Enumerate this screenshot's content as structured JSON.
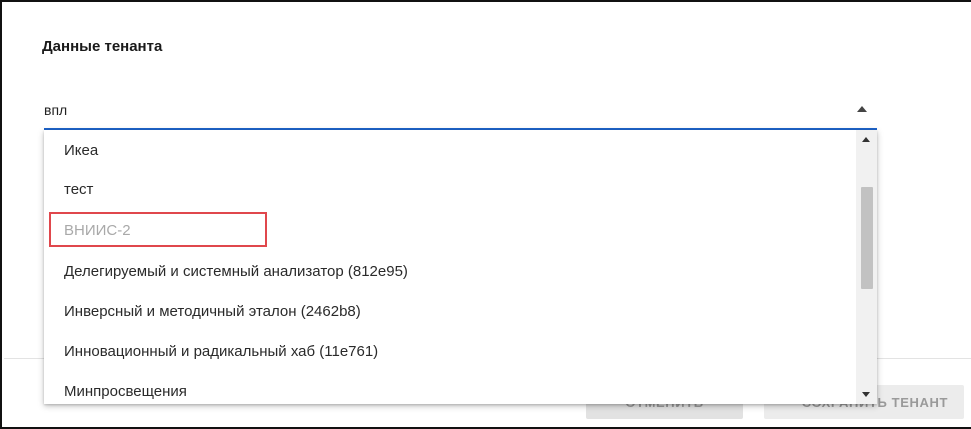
{
  "section": {
    "title": "Данные тенанта"
  },
  "tenant_select": {
    "value": "впл",
    "options": [
      {
        "label": "Икеа",
        "disabled": false
      },
      {
        "label": "тест",
        "disabled": false
      },
      {
        "label": "ВНИИС-2",
        "disabled": true,
        "highlighted": true
      },
      {
        "label": "Делегируемый и системный анализатор (812e95)",
        "disabled": false
      },
      {
        "label": "Инверсный и методичный эталон (2462b8)",
        "disabled": false
      },
      {
        "label": "Инновационный и радикальный хаб (11e761)",
        "disabled": false
      },
      {
        "label": "Минпросвещения",
        "disabled": false
      }
    ]
  },
  "footer": {
    "cancel_label": "ОТМЕНИТЬ",
    "save_label": "СОХРАНИТЬ ТЕНАНТ"
  },
  "colors": {
    "accent_underline": "#1e63c9",
    "highlight_border": "#e0474c",
    "disabled_text": "#a9a9a9"
  }
}
